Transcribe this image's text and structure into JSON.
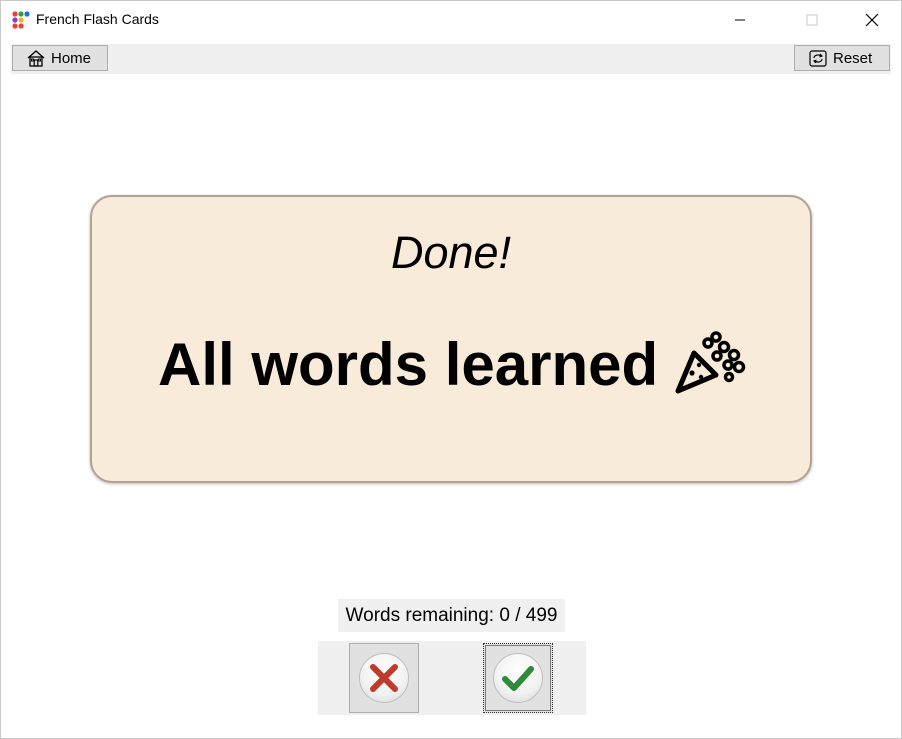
{
  "window": {
    "title": "French Flash Cards"
  },
  "toolbar": {
    "home_label": "Home",
    "reset_label": "Reset"
  },
  "card": {
    "subtitle": "Done!",
    "message": "All words learned",
    "background": "#f9ebd9",
    "border": "#b3a291"
  },
  "status": {
    "remaining_text": "Words remaining: 0 / 499"
  },
  "answers": {
    "wrong_icon": "x-mark-icon",
    "right_icon": "check-mark-icon",
    "wrong_color": "#c0392b",
    "right_color": "#2e8b3a"
  },
  "icons": {
    "app": "colored-dots-icon",
    "home": "house-icon",
    "reset": "refresh-icon",
    "celebration": "party-popper-icon"
  }
}
